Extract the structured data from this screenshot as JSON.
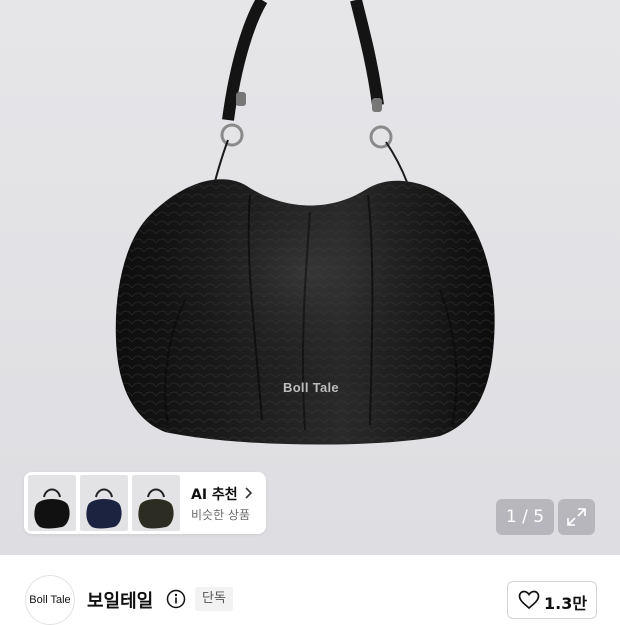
{
  "product_image": {
    "bag_logo_text": "Boll Tale"
  },
  "recommendation": {
    "title": "AI 추천",
    "subtitle": "비슷한 상품",
    "thumbnails": [
      {
        "color": "#111111"
      },
      {
        "color": "#1c2340"
      },
      {
        "color": "#2c2c22"
      }
    ]
  },
  "gallery": {
    "pager_text": "1 / 5"
  },
  "brand": {
    "avatar_text": "Boll Tale",
    "name": "보일테일",
    "badge": "단독"
  },
  "like": {
    "count": "1.3만"
  },
  "icons": {
    "info": "info-icon",
    "expand": "expand-icon",
    "heart": "heart-icon",
    "chevron": "chevron-right-icon"
  }
}
